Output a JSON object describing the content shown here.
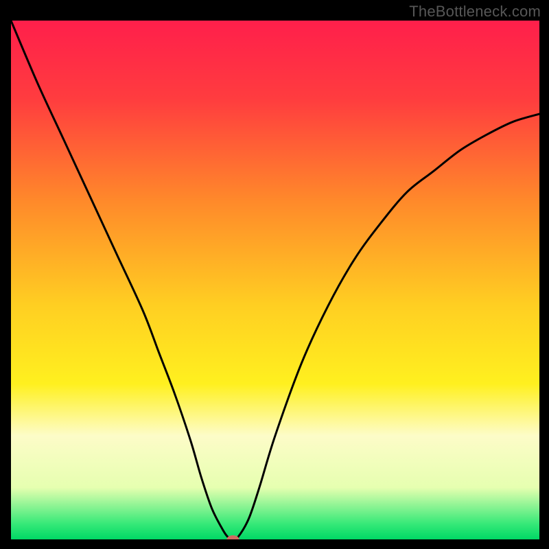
{
  "watermark": "TheBottleneck.com",
  "chart_data": {
    "type": "line",
    "title": "",
    "xlabel": "",
    "ylabel": "",
    "xlim": [
      0,
      100
    ],
    "ylim": [
      0,
      100
    ],
    "grid": false,
    "gradient_stops": [
      {
        "offset": 0,
        "color": "#ff1f4b"
      },
      {
        "offset": 15,
        "color": "#ff3c3f"
      },
      {
        "offset": 35,
        "color": "#ff8a2a"
      },
      {
        "offset": 55,
        "color": "#ffcf22"
      },
      {
        "offset": 70,
        "color": "#fff01f"
      },
      {
        "offset": 80,
        "color": "#fdfcc8"
      },
      {
        "offset": 90,
        "color": "#e6ffb0"
      },
      {
        "offset": 97,
        "color": "#36e978"
      },
      {
        "offset": 100,
        "color": "#00d865"
      }
    ],
    "series": [
      {
        "name": "bottleneck-curve",
        "x": [
          0,
          5,
          10,
          15,
          20,
          25,
          28,
          31,
          34,
          36,
          38,
          40,
          41,
          42,
          43,
          45,
          47,
          50,
          55,
          60,
          65,
          70,
          75,
          80,
          85,
          90,
          95,
          100
        ],
        "y": [
          100,
          88,
          77,
          66,
          55,
          44,
          36,
          28,
          19,
          12,
          6,
          2,
          0.5,
          0,
          0.5,
          4,
          10,
          20,
          34,
          45,
          54,
          61,
          67,
          71,
          75,
          78,
          80.5,
          82
        ]
      }
    ],
    "marker": {
      "name": "optimal-point",
      "x": 42,
      "y": 0,
      "color": "#cf6a61",
      "rx": 9,
      "ry": 6
    }
  }
}
